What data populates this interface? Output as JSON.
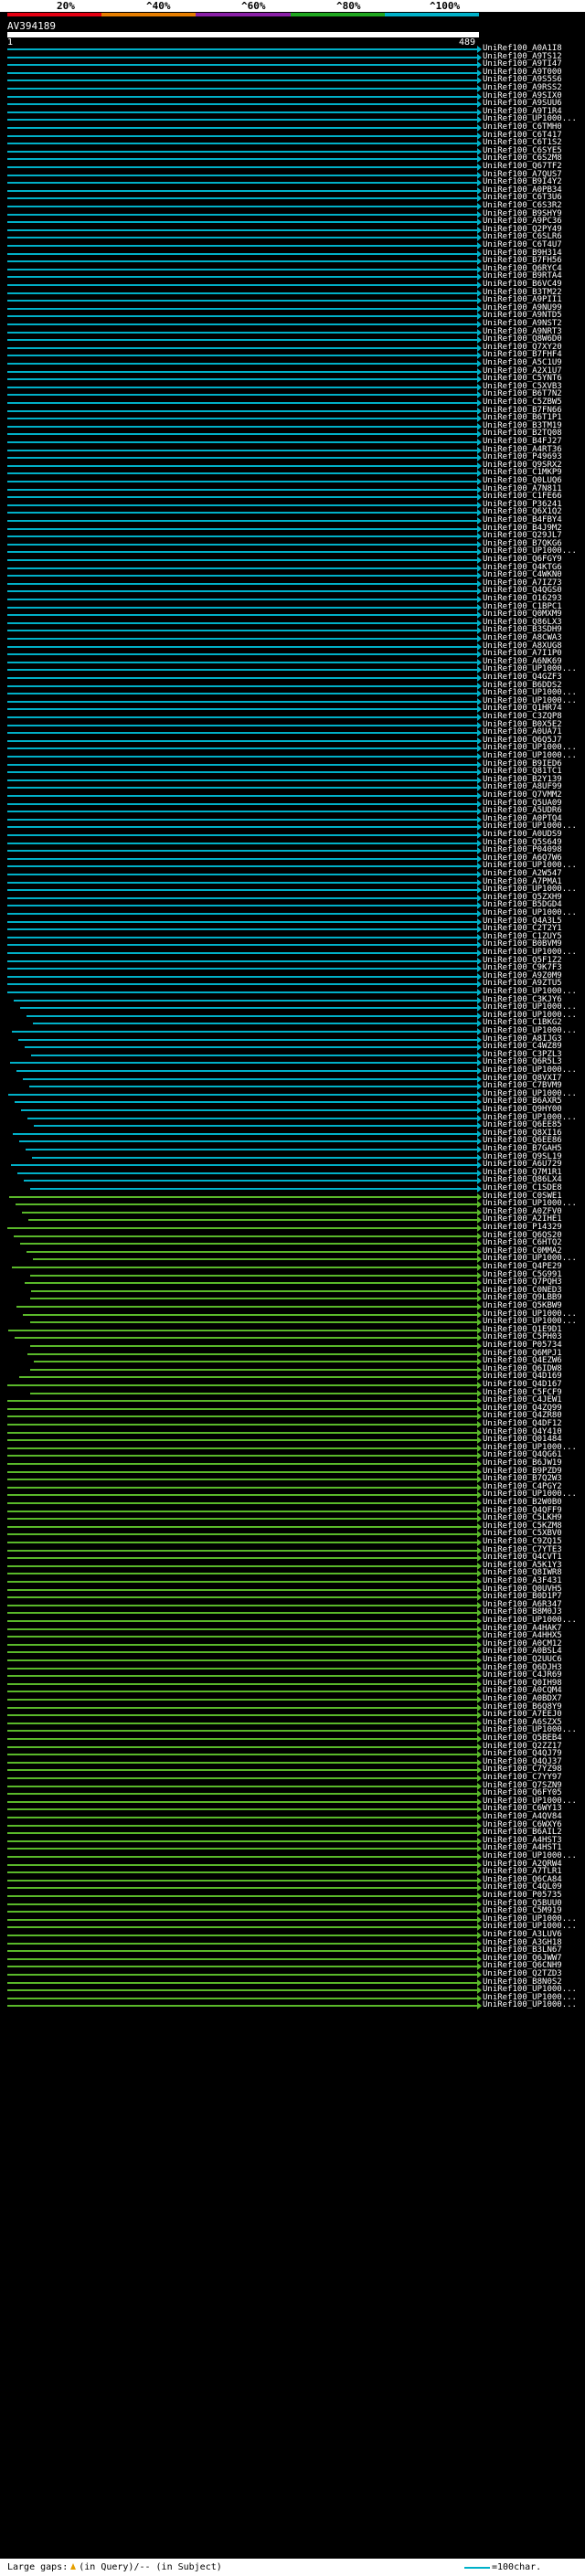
{
  "header": {
    "scale_labels": [
      "20%",
      "^40%",
      "^60%",
      "^80%",
      "^100%"
    ],
    "color_bands": [
      {
        "label": "0-20%",
        "color": "#e60012"
      },
      {
        "label": "20-40%",
        "color": "#e67e00"
      },
      {
        "label": "40-60%",
        "color": "#8a1fa6"
      },
      {
        "label": "60-80%",
        "color": "#1fa61f"
      },
      {
        "label": "80-100%",
        "color": "#00b0c8"
      }
    ],
    "query_id": "AV394189",
    "query_start": "1",
    "query_end": "489"
  },
  "colors": {
    "high": "#00b0c8",
    "mid": "#5ab82a",
    "background": "#000000"
  },
  "hits": [
    "UniRef100_A0A1I8",
    "UniRef100_A9TS12",
    "UniRef100_A9TI47",
    "UniRef100_A9T000",
    "UniRef100_A9S5S6",
    "UniRef100_A9RSS2",
    "UniRef100_A9SIX0",
    "UniRef100_A9SUU6",
    "UniRef100_A9T1R4",
    "UniRef100_UP1000...",
    "UniRef100_C6TMH0",
    "UniRef100_C6T417",
    "UniRef100_C6T1S2",
    "UniRef100_C6SYE5",
    "UniRef100_C6S2M8",
    "UniRef100_Q67TF2",
    "UniRef100_A7QUS7",
    "UniRef100_B9I4Y2",
    "UniRef100_A0PB34",
    "UniRef100_C6T3U6",
    "UniRef100_C6S3R2",
    "UniRef100_B9SHY9",
    "UniRef100_A9PC36",
    "UniRef100_Q2PY49",
    "UniRef100_C6SLR6",
    "UniRef100_C6T4U7",
    "UniRef100_B9H314",
    "UniRef100_B7FH56",
    "UniRef100_Q6RYC4",
    "UniRef100_B9RTA4",
    "UniRef100_B6VC49",
    "UniRef100_B3TM22",
    "UniRef100_A9PII1",
    "UniRef100_A9NU99",
    "UniRef100_A9NTD5",
    "UniRef100_A9NST2",
    "UniRef100_A9NRT3",
    "UniRef100_Q8W6D0",
    "UniRef100_Q7XY20",
    "UniRef100_B7FHF4",
    "UniRef100_A5C1U9",
    "UniRef100_A2X1U7",
    "UniRef100_C5YNT6",
    "UniRef100_C5XVB3",
    "UniRef100_B6T7N2",
    "UniRef100_C5ZBW5",
    "UniRef100_B7FN66",
    "UniRef100_B6T1P1",
    "UniRef100_B3TM19",
    "UniRef100_B2TQ08",
    "UniRef100_B4FJ27",
    "UniRef100_A4RT36",
    "UniRef100_P49693",
    "UniRef100_Q9SRX2",
    "UniRef100_C1MKP9",
    "UniRef100_Q0LUQ6",
    "UniRef100_A7N811",
    "UniRef100_C1FE66",
    "UniRef100_P36241",
    "UniRef100_Q6X1Q2",
    "UniRef100_B4FBY4",
    "UniRef100_B4J9M2",
    "UniRef100_Q29JL7",
    "UniRef100_B7QKG6",
    "UniRef100_UP1000...",
    "UniRef100_Q6FGY9",
    "UniRef100_Q4KTG6",
    "UniRef100_C4WKN0",
    "UniRef100_A7IZ73",
    "UniRef100_Q4QGS0",
    "UniRef100_O16293",
    "UniRef100_C1BPC1",
    "UniRef100_Q0MXM9",
    "UniRef100_Q86LX3",
    "UniRef100_B3SDH9",
    "UniRef100_A8CWA3",
    "UniRef100_A8XUG8",
    "UniRef100_A7I1P0",
    "UniRef100_A6NK69",
    "UniRef100_UP1000...",
    "UniRef100_Q4GZF3",
    "UniRef100_B6DDS2",
    "UniRef100_UP1000...",
    "UniRef100_UP1000...",
    "UniRef100_Q1HR74",
    "UniRef100_C3ZQP8",
    "UniRef100_B0X5E2",
    "UniRef100_A0UA71",
    "UniRef100_Q6Q5J7",
    "UniRef100_UP1000...",
    "UniRef100_UP1000...",
    "UniRef100_B9IED6",
    "UniRef100_Q81TC1",
    "UniRef100_B2Y139",
    "UniRef100_A8UF99",
    "UniRef100_Q7VMM2",
    "UniRef100_Q5UA09",
    "UniRef100_A5UDR6",
    "UniRef100_A0PTQ4",
    "UniRef100_UP1000...",
    "UniRef100_A0UDS9",
    "UniRef100_Q5S649",
    "UniRef100_P04098",
    "UniRef100_A6Q7W6",
    "UniRef100_UP1000...",
    "UniRef100_A2W547",
    "UniRef100_A7PMA1",
    "UniRef100_UP1000...",
    "UniRef100_Q5ZXH9",
    "UniRef100_B5DGD4",
    "UniRef100_UP1000...",
    "UniRef100_Q4A3L5",
    "UniRef100_C2T2Y1",
    "UniRef100_C1ZUY5",
    "UniRef100_B0BVM9",
    "UniRef100_UP1000...",
    "UniRef100_Q5F1Z2",
    "UniRef100_C9K7F3",
    "UniRef100_A9Z0M9",
    "UniRef100_A9ZTU5",
    "UniRef100_UP1000...",
    "UniRef100_C3KJY6",
    "UniRef100_UP1000...",
    "UniRef100_UP1000...",
    "UniRef100_C1BKG2",
    "UniRef100_UP1000...",
    "UniRef100_A8IJG3",
    "UniRef100_C4WZ89",
    "UniRef100_C3PZL3",
    "UniRef100_Q6R5L3",
    "UniRef100_UP1000...",
    "UniRef100_Q8VXI7",
    "UniRef100_C7BVM9",
    "UniRef100_UP1000...",
    "UniRef100_B6AXR5",
    "UniRef100_Q9HY00",
    "UniRef100_UP1000...",
    "UniRef100_Q6EE85",
    "UniRef100_Q8XI16",
    "UniRef100_Q6EE86",
    "UniRef100_B7GAH5",
    "UniRef100_Q9SL19",
    "UniRef100_A6U729",
    "UniRef100_Q7M1R1",
    "UniRef100_Q86LX4",
    "UniRef100_C1SDE8",
    "UniRef100_C0SWE1",
    "UniRef100_UP1000...",
    "UniRef100_A0ZFV0",
    "UniRef100_A2IHE1",
    "UniRef100_P14329",
    "UniRef100_Q6QS20",
    "UniRef100_C6HTQ2",
    "UniRef100_C0MMA2",
    "UniRef100_UP1000...",
    "UniRef100_Q4PE29",
    "UniRef100_C5G991",
    "UniRef100_Q7PQH3",
    "UniRef100_C0NED3",
    "UniRef100_Q9LBB9",
    "UniRef100_Q5KBW9",
    "UniRef100_UP1000...",
    "UniRef100_UP1000...",
    "UniRef100_Q1E9D1",
    "UniRef100_C5PH03",
    "UniRef100_P05734",
    "UniRef100_Q6MPJ1",
    "UniRef100_Q4EZW6",
    "UniRef100_Q6IDW8",
    "UniRef100_Q4D169",
    "UniRef100_Q4D167",
    "UniRef100_C5FCF9",
    "UniRef100_C4JEW1",
    "UniRef100_Q4ZQ99",
    "UniRef100_Q4ZR80",
    "UniRef100_Q4DF12",
    "UniRef100_Q4Y410",
    "UniRef100_Q01484",
    "UniRef100_UP1000...",
    "UniRef100_Q4QG61",
    "UniRef100_B6JW19",
    "UniRef100_B9PZD9",
    "UniRef100_B7Q2W3",
    "UniRef100_C4PGY2",
    "UniRef100_UP1000...",
    "UniRef100_B2W0B0",
    "UniRef100_Q4QFF9",
    "UniRef100_C5LKH9",
    "UniRef100_C5KZM8",
    "UniRef100_C5XBV0",
    "UniRef100_C9ZQ15",
    "UniRef100_C7YTE3",
    "UniRef100_Q4CVT1",
    "UniRef100_A5K1Y3",
    "UniRef100_Q8IWR8",
    "UniRef100_A3F431",
    "UniRef100_Q0UVH5",
    "UniRef100_B0D1P7",
    "UniRef100_A6R347",
    "UniRef100_B8M0J3",
    "UniRef100_UP1000...",
    "UniRef100_A4HAK7",
    "UniRef100_A4HHX5",
    "UniRef100_A0CM12",
    "UniRef100_A0BSL4",
    "UniRef100_Q2UUC6",
    "UniRef100_Q6DJH3",
    "UniRef100_C4JR69",
    "UniRef100_Q0IH98",
    "UniRef100_A0CQM4",
    "UniRef100_A0BDX7",
    "UniRef100_B6Q8Y9",
    "UniRef100_A7EEJ0",
    "UniRef100_A6SZX5",
    "UniRef100_UP1000...",
    "UniRef100_Q5BEB4",
    "UniRef100_Q2ZZ17",
    "UniRef100_Q4QJ79",
    "UniRef100_Q4QJ37",
    "UniRef100_C7YZ98",
    "UniRef100_C7YY97",
    "UniRef100_Q7SZN9",
    "UniRef100_Q6FY05",
    "UniRef100_UP1000...",
    "UniRef100_C6WY13",
    "UniRef100_A4QV84",
    "UniRef100_C6WXY6",
    "UniRef100_B6AIL2",
    "UniRef100_A4HST3",
    "UniRef100_A4HST1",
    "UniRef100_UP1000...",
    "UniRef100_A2QRW4",
    "UniRef100_A7TLR1",
    "UniRef100_Q6CA84",
    "UniRef100_C4QL09",
    "UniRef100_P05735",
    "UniRef100_Q5BUU0",
    "UniRef100_C5M919",
    "UniRef100_UP1000...",
    "UniRef100_UP1000...",
    "UniRef100_A3LUV6",
    "UniRef100_A3GH18",
    "UniRef100_B3LN67",
    "UniRef100_Q6JWW7",
    "UniRef100_Q6CNH9",
    "UniRef100_Q2TZD3",
    "UniRef100_B8N0S2",
    "UniRef100_UP1000...",
    "UniRef100_UP1000...",
    "UniRef100_UP1000..."
  ],
  "legend": {
    "gaps_text": "Large gaps:",
    "gaps_query_text": "(in Query)/-- (in Subject)",
    "scale_text": "=100char."
  }
}
